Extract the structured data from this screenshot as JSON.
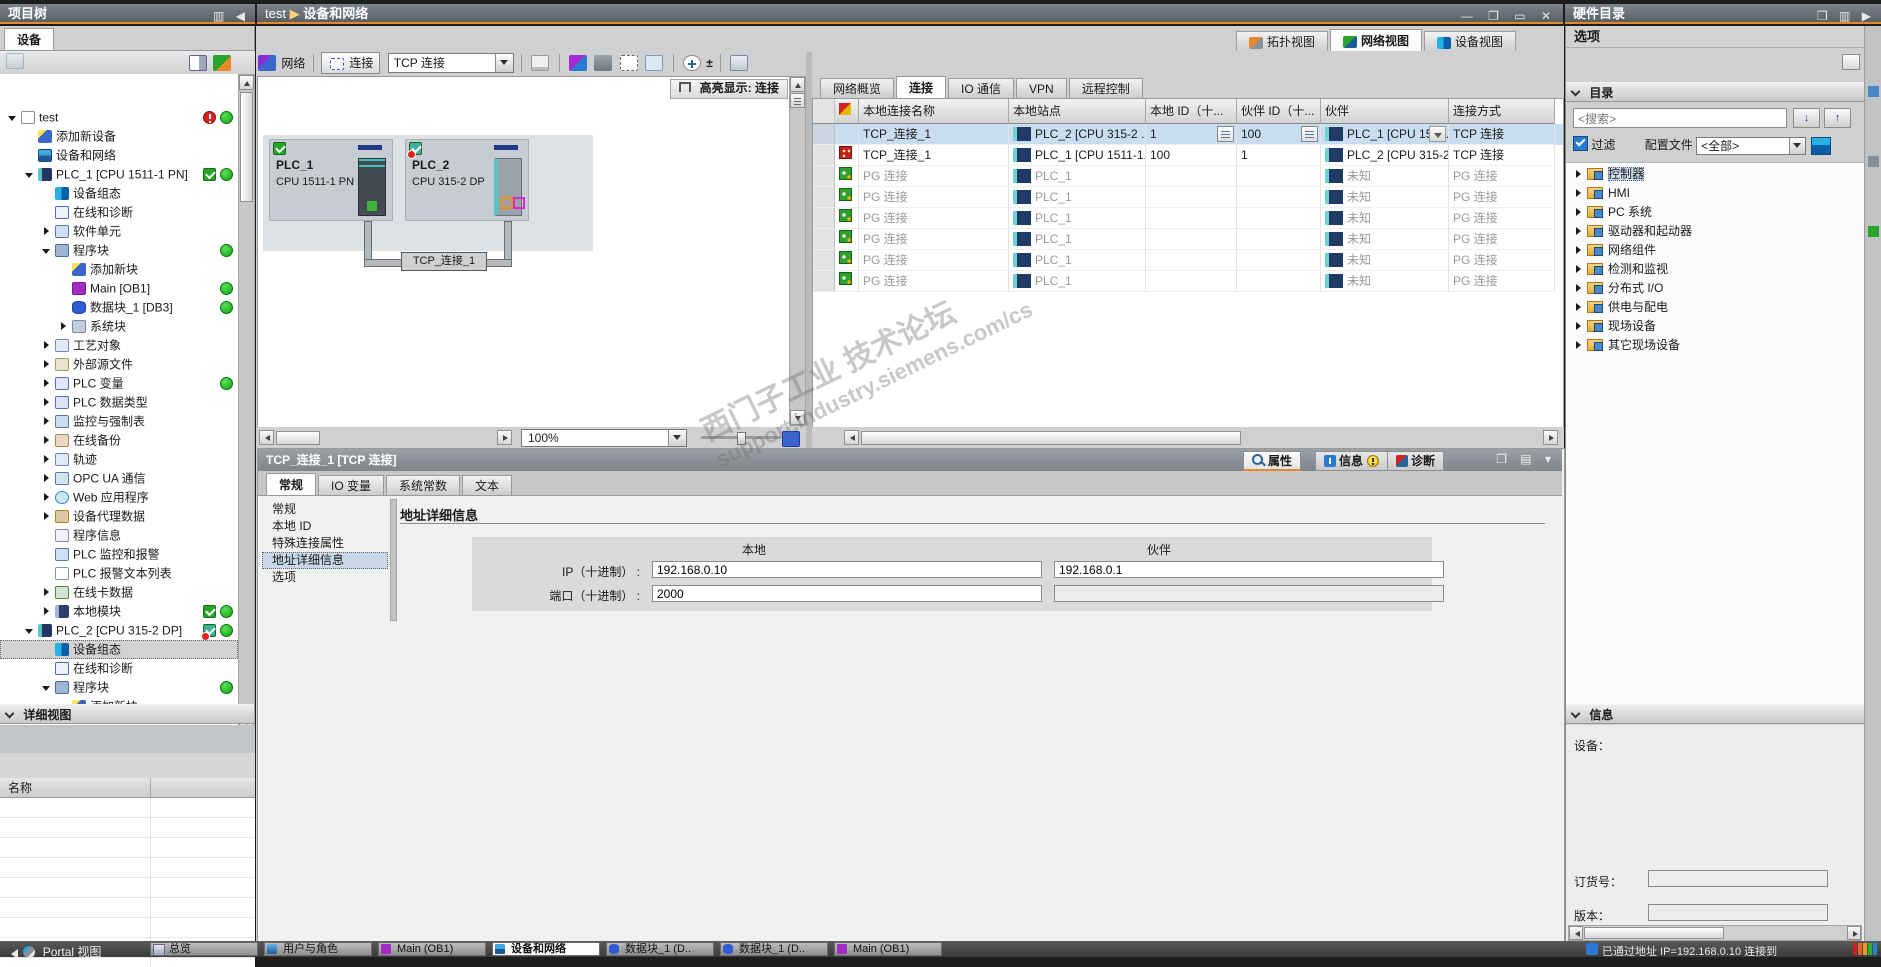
{
  "titlebar": {
    "left": "项目树",
    "breadcrumb_root": "test",
    "breadcrumb_page": "设备和网络",
    "right": "硬件目录",
    "window_controls": [
      "minimize-icon",
      "restore-icon",
      "maximize-icon",
      "close-icon"
    ]
  },
  "left_panel": {
    "tab": "设备",
    "detail_header": "详细视图",
    "detail_name_col": "名称",
    "tree": [
      {
        "label": "test",
        "lvl": 0,
        "exp": "open",
        "icon": "project",
        "b1": "err",
        "b2": "ok"
      },
      {
        "label": "添加新设备",
        "lvl": 1,
        "icon": "add"
      },
      {
        "label": "设备和网络",
        "lvl": 1,
        "icon": "net"
      },
      {
        "label": "PLC_1 [CPU 1511-1 PN]",
        "lvl": 1,
        "exp": "open",
        "icon": "plc",
        "b1": "chk",
        "b2": "ok"
      },
      {
        "label": "设备组态",
        "lvl": 2,
        "icon": "devconf"
      },
      {
        "label": "在线和诊断",
        "lvl": 2,
        "icon": "diag"
      },
      {
        "label": "软件单元",
        "lvl": 2,
        "exp": "closed",
        "icon": "swunit"
      },
      {
        "label": "程序块",
        "lvl": 2,
        "exp": "open",
        "icon": "blocks",
        "b2": "ok"
      },
      {
        "label": "添加新块",
        "lvl": 3,
        "icon": "add"
      },
      {
        "label": "Main [OB1]",
        "lvl": 3,
        "icon": "ob",
        "b2": "ok"
      },
      {
        "label": "数据块_1 [DB3]",
        "lvl": 3,
        "icon": "db",
        "b2": "ok"
      },
      {
        "label": "系统块",
        "lvl": 3,
        "exp": "closed",
        "icon": "sysblocks"
      },
      {
        "label": "工艺对象",
        "lvl": 2,
        "exp": "closed",
        "icon": "tech"
      },
      {
        "label": "外部源文件",
        "lvl": 2,
        "exp": "closed",
        "icon": "extsrc"
      },
      {
        "label": "PLC 变量",
        "lvl": 2,
        "exp": "closed",
        "icon": "tags",
        "b2": "ok"
      },
      {
        "label": "PLC 数据类型",
        "lvl": 2,
        "exp": "closed",
        "icon": "types"
      },
      {
        "label": "监控与强制表",
        "lvl": 2,
        "exp": "closed",
        "icon": "watch"
      },
      {
        "label": "在线备份",
        "lvl": 2,
        "exp": "closed",
        "icon": "backup"
      },
      {
        "label": "轨迹",
        "lvl": 2,
        "exp": "closed",
        "icon": "trace"
      },
      {
        "label": "OPC UA 通信",
        "lvl": 2,
        "exp": "closed",
        "icon": "opcua"
      },
      {
        "label": "Web 应用程序",
        "lvl": 2,
        "exp": "closed",
        "icon": "web"
      },
      {
        "label": "设备代理数据",
        "lvl": 2,
        "exp": "closed",
        "icon": "proxy"
      },
      {
        "label": "程序信息",
        "lvl": 2,
        "icon": "proginfo"
      },
      {
        "label": "PLC 监控和报警",
        "lvl": 2,
        "icon": "alarm"
      },
      {
        "label": "PLC 报警文本列表",
        "lvl": 2,
        "icon": "alarmtext"
      },
      {
        "label": "在线卡数据",
        "lvl": 2,
        "exp": "closed",
        "icon": "card"
      },
      {
        "label": "本地模块",
        "lvl": 2,
        "exp": "closed",
        "icon": "modules",
        "b1": "chk",
        "b2": "ok"
      },
      {
        "label": "PLC_2 [CPU 315-2 DP]",
        "lvl": 1,
        "exp": "open",
        "icon": "plc",
        "b1": "chkerr",
        "b2": "ok"
      },
      {
        "label": "设备组态",
        "lvl": 2,
        "icon": "devconf",
        "sel": true
      },
      {
        "label": "在线和诊断",
        "lvl": 2,
        "icon": "diag"
      },
      {
        "label": "程序块",
        "lvl": 2,
        "exp": "open",
        "icon": "blocks",
        "b2": "ok"
      },
      {
        "label": "添加新块",
        "lvl": 3,
        "icon": "add"
      }
    ]
  },
  "network_editor": {
    "toolbar": {
      "network": "网络",
      "connections": "连接",
      "type_value": "TCP 连接"
    },
    "highlight": "高亮显示: 连接",
    "zoom_value": "100%",
    "devices": {
      "plc1_name": "PLC_1",
      "plc1_cpu": "CPU 1511-1 PN",
      "plc2_name": "PLC_2",
      "plc2_cpu": "CPU 315-2 DP",
      "connection_label": "TCP_连接_1"
    }
  },
  "view_buttons": [
    {
      "label": "拓扑视图",
      "icon": "topo"
    },
    {
      "label": "网络视图",
      "icon": "netv",
      "active": true
    },
    {
      "label": "设备视图",
      "icon": "devv"
    }
  ],
  "conn_table": {
    "tabs": [
      {
        "label": "网络概览"
      },
      {
        "label": "连接",
        "active": true
      },
      {
        "label": "IO 通信"
      },
      {
        "label": "VPN"
      },
      {
        "label": "远程控制"
      }
    ],
    "columns": [
      "本地连接名称",
      "本地站点",
      "本地 ID（十...",
      "伙伴 ID（十...",
      "伙伴",
      "连接方式"
    ],
    "rows": [
      {
        "icon": "",
        "name": "TCP_连接_1",
        "station": "PLC_2 [CPU 315-2 ...",
        "local_id": "1",
        "partner_id": "100",
        "partner": "PLC_1 [CPU 151...",
        "type": "TCP 连接",
        "selected": true
      },
      {
        "icon": "error",
        "name": "TCP_连接_1",
        "station": "PLC_1 [CPU 1511-1...",
        "local_id": "100",
        "partner_id": "1",
        "partner": "PLC_2 [CPU 315-2 ...",
        "type": "TCP 连接"
      },
      {
        "icon": "pg",
        "name": "PG 连接",
        "station": "PLC_1",
        "local_id": "",
        "partner_id": "",
        "partner": "未知",
        "type": "PG 连接",
        "gray": true
      },
      {
        "icon": "pg",
        "name": "PG 连接",
        "station": "PLC_1",
        "local_id": "",
        "partner_id": "",
        "partner": "未知",
        "type": "PG 连接",
        "gray": true
      },
      {
        "icon": "pg",
        "name": "PG 连接",
        "station": "PLC_1",
        "local_id": "",
        "partner_id": "",
        "partner": "未知",
        "type": "PG 连接",
        "gray": true
      },
      {
        "icon": "pg",
        "name": "PG 连接",
        "station": "PLC_1",
        "local_id": "",
        "partner_id": "",
        "partner": "未知",
        "type": "PG 连接",
        "gray": true
      },
      {
        "icon": "pg",
        "name": "PG 连接",
        "station": "PLC_1",
        "local_id": "",
        "partner_id": "",
        "partner": "未知",
        "type": "PG 连接",
        "gray": true
      },
      {
        "icon": "pg",
        "name": "PG 连接",
        "station": "PLC_1",
        "local_id": "",
        "partner_id": "",
        "partner": "未知",
        "type": "PG 连接",
        "gray": true
      }
    ]
  },
  "inspector": {
    "title": "TCP_连接_1 [TCP 连接]",
    "buttons": [
      {
        "label": "属性",
        "icon": "properties-icon",
        "active": true
      },
      {
        "label": "信息",
        "icon": "info-icon",
        "warn": true
      },
      {
        "label": "诊断",
        "icon": "diagnostics-icon"
      }
    ],
    "tabs": [
      {
        "label": "常规",
        "active": true
      },
      {
        "label": "IO 变量"
      },
      {
        "label": "系统常数"
      },
      {
        "label": "文本"
      }
    ],
    "nav": [
      {
        "label": "常规"
      },
      {
        "label": "本地 ID"
      },
      {
        "label": "特殊连接属性"
      },
      {
        "label": "地址详细信息",
        "selected": true
      },
      {
        "label": "选项"
      }
    ],
    "heading": "地址详细信息",
    "local_col": "本地",
    "partner_col": "伙伴",
    "ip_label": "IP（十进制） :",
    "port_label": "端口（十进制） :",
    "ip_local": "192.168.0.10",
    "ip_partner": "192.168.0.1",
    "port_local": "2000",
    "port_partner": ""
  },
  "catalog": {
    "options": "选项",
    "catalog": "目录",
    "search_value": "<搜索>",
    "filter": "过滤",
    "profile_label": "配置文件",
    "profile_value": "<全部>",
    "items": [
      {
        "label": "控制器",
        "selected": true
      },
      {
        "label": "HMI"
      },
      {
        "label": "PC 系统"
      },
      {
        "label": "驱动器和起动器"
      },
      {
        "label": "网络组件"
      },
      {
        "label": "检测和监视"
      },
      {
        "label": "分布式 I/O"
      },
      {
        "label": "供电与配电"
      },
      {
        "label": "现场设备"
      },
      {
        "label": "其它现场设备"
      }
    ],
    "info": "信息",
    "device_label": "设备：",
    "order_label": "订货号：",
    "version_label": "版本："
  },
  "statusbar": {
    "portal": "Portal 视图",
    "tasks": [
      {
        "label": "总览",
        "icon": "overview"
      },
      {
        "label": "用户与角色",
        "icon": "users"
      },
      {
        "label": "Main (OB1)",
        "icon": "ob"
      },
      {
        "label": "设备和网络",
        "icon": "net",
        "active": true
      },
      {
        "label": "数据块_1 (D..",
        "icon": "db"
      },
      {
        "label": "数据块_1 (D..",
        "icon": "db"
      },
      {
        "label": "Main (OB1)",
        "icon": "ob"
      }
    ],
    "status": "已通过地址 IP=192.168.0.10 连接到"
  },
  "watermark": {
    "line1": "西门子工业 技术论坛",
    "line2": "support.industry.siemens.com/cs"
  }
}
